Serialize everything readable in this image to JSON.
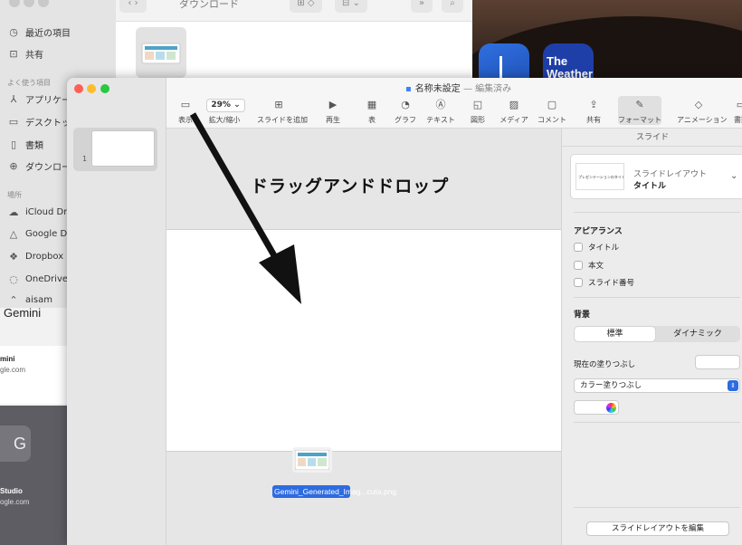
{
  "background": {
    "weather_app_label": "The\nWeather",
    "gemini_title": "Gemini",
    "card1_name": "mini",
    "card1_url": "gle.com",
    "card2_badge": "G",
    "card2_name": "Studio",
    "card2_url": "ogle.com"
  },
  "finder": {
    "title": "ダウンロード",
    "nav_back": "‹",
    "nav_forward": "›",
    "view_btn": "⊞ ◇",
    "group_btn": "⊟ ⌄",
    "more_btn": "»",
    "search_btn": "⌕",
    "sidebar": {
      "recents": "最近の項目",
      "shared": "共有",
      "favorites_header": "よく使う項目",
      "applications": "アプリケー",
      "desktop": "デスクトッ",
      "documents": "書類",
      "downloads": "ダウンロー",
      "locations_header": "場所",
      "icloud": "iCloud Dri",
      "google_drive": "Google Dr",
      "dropbox": "Dropbox",
      "onedrive": "OneDrive",
      "partial": "aisam"
    }
  },
  "keynote": {
    "title": "名称未設定",
    "title_status": "— 編集済み",
    "slide_number": "1",
    "zoom": "29% ⌄",
    "toolbar": [
      {
        "icon": "▭",
        "label": "表示"
      },
      {
        "icon": "",
        "label": "拡大/縮小"
      },
      {
        "icon": "⊞",
        "label": "スライドを追加"
      },
      {
        "icon": "▶",
        "label": "再生"
      },
      {
        "icon": "▦",
        "label": "表"
      },
      {
        "icon": "◔",
        "label": "グラフ"
      },
      {
        "icon": "Ⓐ",
        "label": "テキスト"
      },
      {
        "icon": "◱",
        "label": "図形"
      },
      {
        "icon": "▨",
        "label": "メディア"
      },
      {
        "icon": "▢",
        "label": "コメント"
      },
      {
        "icon": "⇪",
        "label": "共有"
      },
      {
        "icon": "✎",
        "label": "フォーマット"
      },
      {
        "icon": "◇",
        "label": "アニメーション"
      },
      {
        "icon": "▭",
        "label": "書類"
      }
    ],
    "annotation": "ドラッグアンドドロップ",
    "dropped_file_name": "Gemini_Generated_Imag...cuta.png"
  },
  "inspector": {
    "header": "スライド",
    "layout_mini_text": "プレゼンテーションのタイトル",
    "layout_name": "スライドレイアウト",
    "layout_value": "タイトル",
    "appearance_header": "アピアランス",
    "cb_title": "タイトル",
    "cb_body": "本文",
    "cb_slide_number": "スライド番号",
    "background_header": "背景",
    "seg_standard": "標準",
    "seg_dynamic": "ダイナミック",
    "current_fill_label": "現在の塗りつぶし",
    "fill_type": "カラー塗りつぶし",
    "edit_layout_button": "スライドレイアウトを編集"
  },
  "colors": {
    "accent": "#2d6be0",
    "close": "#ff5f57",
    "minimize": "#febc2e",
    "zoom": "#28c840"
  }
}
